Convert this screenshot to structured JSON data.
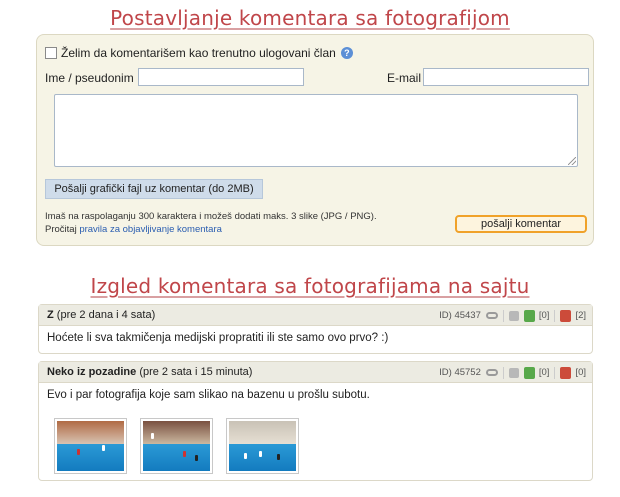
{
  "headings": {
    "form_title": "Postavljanje komentara sa fotografijom",
    "preview_title": "Izgled komentara sa fotografijama na sajtu"
  },
  "form": {
    "login_checkbox_label": "Želim da komentarišem kao trenutno ulogovani član",
    "help_icon_glyph": "?",
    "name_label": "Ime / pseudonim",
    "name_value": "",
    "email_label": "E-mail",
    "email_value": "",
    "comment_value": "",
    "upload_button": "Pošalji grafički fajl uz komentar (do 2MB)",
    "info_line1": "Imaš na raspolaganju 300 karaktera i možeš dodati maks. 3 slike (JPG / PNG).",
    "info_line2_prefix": "Pročitaj",
    "rules_link": "pravila za objavljivanje komentara",
    "submit_button": "pošalji komentar"
  },
  "comments": [
    {
      "author": "Z",
      "time": "(pre 2 dana i 4 sata)",
      "id_label": "ID) 45437",
      "upvotes": "[0]",
      "downvotes": "[2]",
      "text": "Hoćete li sva takmičenja medijski propratiti ili ste samo ovo prvo? :)"
    },
    {
      "author": "Neko iz pozadine",
      "time": "(pre 2 sata i 15 minuta)",
      "id_label": "ID) 45752",
      "upvotes": "[0]",
      "downvotes": "[0]",
      "text": "Evo i par fotografija koje sam slikao na bazenu u prošlu subotu."
    }
  ],
  "colors": {
    "heading": "#c0464a",
    "panel_bg": "#f6f4e6",
    "submit_border": "#f0a22a",
    "link": "#2a5db0"
  }
}
